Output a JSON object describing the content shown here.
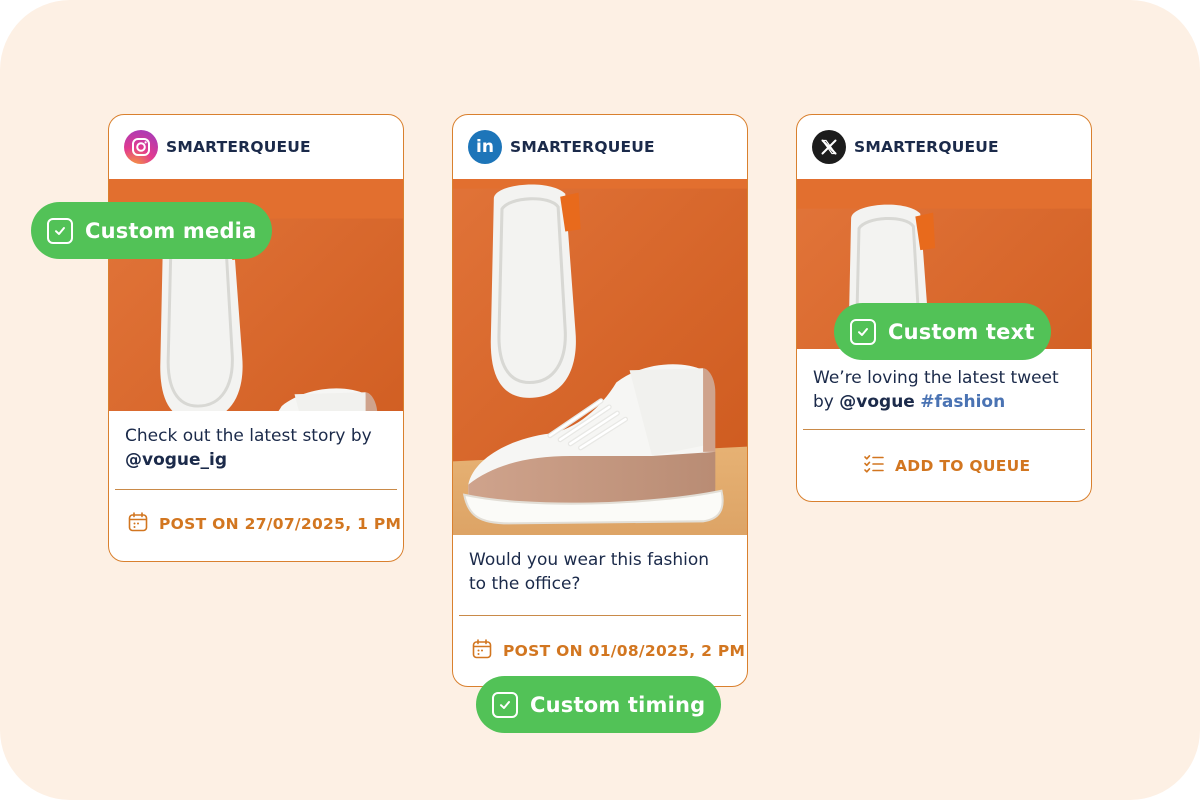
{
  "colors": {
    "background": "#fdf0e4",
    "card_border": "#d9802e",
    "accent_orange": "#d27620",
    "pill_green": "#52c257",
    "text_navy": "#1b2a4a",
    "hashtag_blue": "#4a73b3"
  },
  "cards": [
    {
      "platform": "Instagram",
      "platform_icon": "instagram-icon",
      "brand": "SMARTERQUEUE",
      "caption_text": "Check out the latest story by ",
      "caption_handle": "@vogue_ig",
      "action_icon": "calendar-icon",
      "action_label": "POST ON 27/07/2025, 1 PM"
    },
    {
      "platform": "LinkedIn",
      "platform_icon": "linkedin-icon",
      "platform_icon_text": "in",
      "brand": "SMARTERQUEUE",
      "caption_text": "Would you wear this fashion to the office?",
      "action_icon": "calendar-icon",
      "action_label": "POST ON 01/08/2025, 2 PM"
    },
    {
      "platform": "X",
      "platform_icon": "x-logo-icon",
      "brand": "SMARTERQUEUE",
      "caption_text": "We’re loving the latest tweet by ",
      "caption_handle": "@vogue",
      "caption_hashtag": "#fashion",
      "action_icon": "checklist-icon",
      "action_label": "ADD TO QUEUE"
    }
  ],
  "pills": {
    "custom_media": "Custom media",
    "custom_timing": "Custom timing",
    "custom_text": "Custom text"
  }
}
